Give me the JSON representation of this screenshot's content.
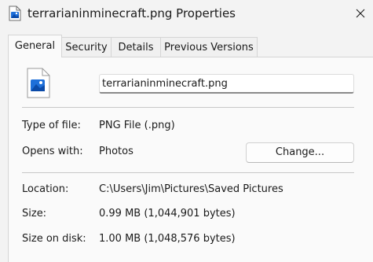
{
  "window": {
    "title": "terrarianinminecraft.png Properties"
  },
  "tabs": [
    {
      "label": "General"
    },
    {
      "label": "Security"
    },
    {
      "label": "Details"
    },
    {
      "label": "Previous Versions"
    }
  ],
  "general": {
    "file_name": "terrarianinminecraft.png",
    "type_label": "Type of file:",
    "type_value": "PNG File (.png)",
    "opens_label": "Opens with:",
    "opens_value": "Photos",
    "change_button": "Change...",
    "location_label": "Location:",
    "location_value": "C:\\Users\\Jim\\Pictures\\Saved Pictures",
    "size_label": "Size:",
    "size_value": "0.99 MB (1,044,901 bytes)",
    "size_disk_label": "Size on disk:",
    "size_disk_value": "1.00 MB (1,048,576 bytes)"
  },
  "icons": {
    "title": "image-file-icon",
    "close": "close-icon",
    "file": "image-file-icon"
  },
  "colors": {
    "icon_blue": "#1e6fd9",
    "background": "#f3f3f3",
    "panel": "#fafafa"
  }
}
